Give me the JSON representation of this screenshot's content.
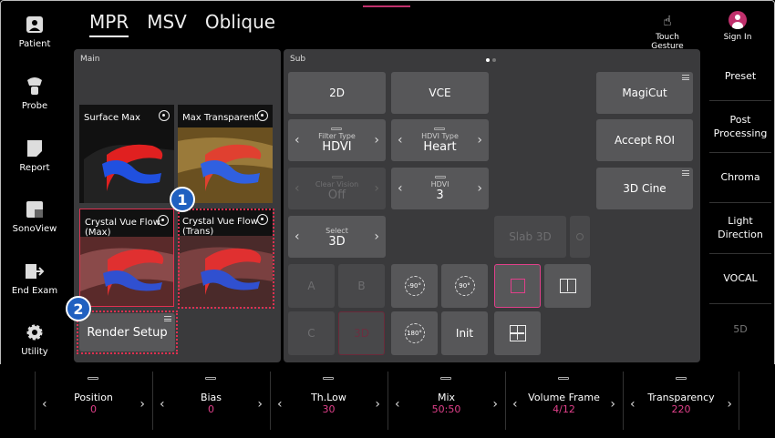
{
  "left_nav": [
    {
      "label": "Patient",
      "icon": "patient-icon"
    },
    {
      "label": "Probe",
      "icon": "probe-icon"
    },
    {
      "label": "Report",
      "icon": "report-icon"
    },
    {
      "label": "SonoView",
      "icon": "sonoview-icon"
    },
    {
      "label": "End Exam",
      "icon": "end-exam-icon"
    },
    {
      "label": "Utility",
      "icon": "gear-icon"
    }
  ],
  "tabs": [
    "MPR",
    "MSV",
    "Oblique"
  ],
  "top_right": {
    "touch_gesture": "Touch Gesture",
    "sign_in": "Sign In"
  },
  "main_panel": {
    "label": "Main",
    "thumbs": [
      {
        "label": "Surface Max"
      },
      {
        "label": "Max Transparent"
      },
      {
        "label": "Crystal Vue Flow\n(Max)"
      },
      {
        "label": "Crystal Vue Flow\n(Trans)"
      }
    ],
    "render_setup": "Render Setup"
  },
  "sub_panel": {
    "label": "Sub",
    "b2d": "2D",
    "vce": "VCE",
    "magicut": "MagiCut",
    "filter_type": {
      "sub": "Filter Type",
      "val": "HDVI"
    },
    "hdvi_type": {
      "sub": "HDVI Type",
      "val": "Heart"
    },
    "accept_roi": "Accept ROI",
    "clear_vision": {
      "sub": "Clear Vision",
      "val": "Off"
    },
    "hdvi": {
      "sub": "HDVI",
      "val": "3"
    },
    "cine3d": "3D Cine",
    "select": {
      "sub": "Select",
      "val": "3D"
    },
    "slab3d": "Slab 3D",
    "a": "A",
    "b": "B",
    "c": "C",
    "d3": "3D",
    "rot_m90": "-90°",
    "rot_90": "90°",
    "rot_180": "180°",
    "init": "Init"
  },
  "right_menu": [
    "Preset",
    "Post\nProcessing",
    "Chroma",
    "Light\nDirection",
    "VOCAL",
    "5D"
  ],
  "bottom_controls": [
    {
      "name": "Position",
      "value": "0"
    },
    {
      "name": "Bias",
      "value": "0"
    },
    {
      "name": "Th.Low",
      "value": "30"
    },
    {
      "name": "Mix",
      "value": "50:50"
    },
    {
      "name": "Volume Frame",
      "value": "4/12"
    },
    {
      "name": "Transparency",
      "value": "220"
    }
  ],
  "callouts": [
    "1",
    "2"
  ],
  "colors": {
    "accent": "#e0408a",
    "callout": "#2060c0",
    "highlight": "#e03050"
  }
}
